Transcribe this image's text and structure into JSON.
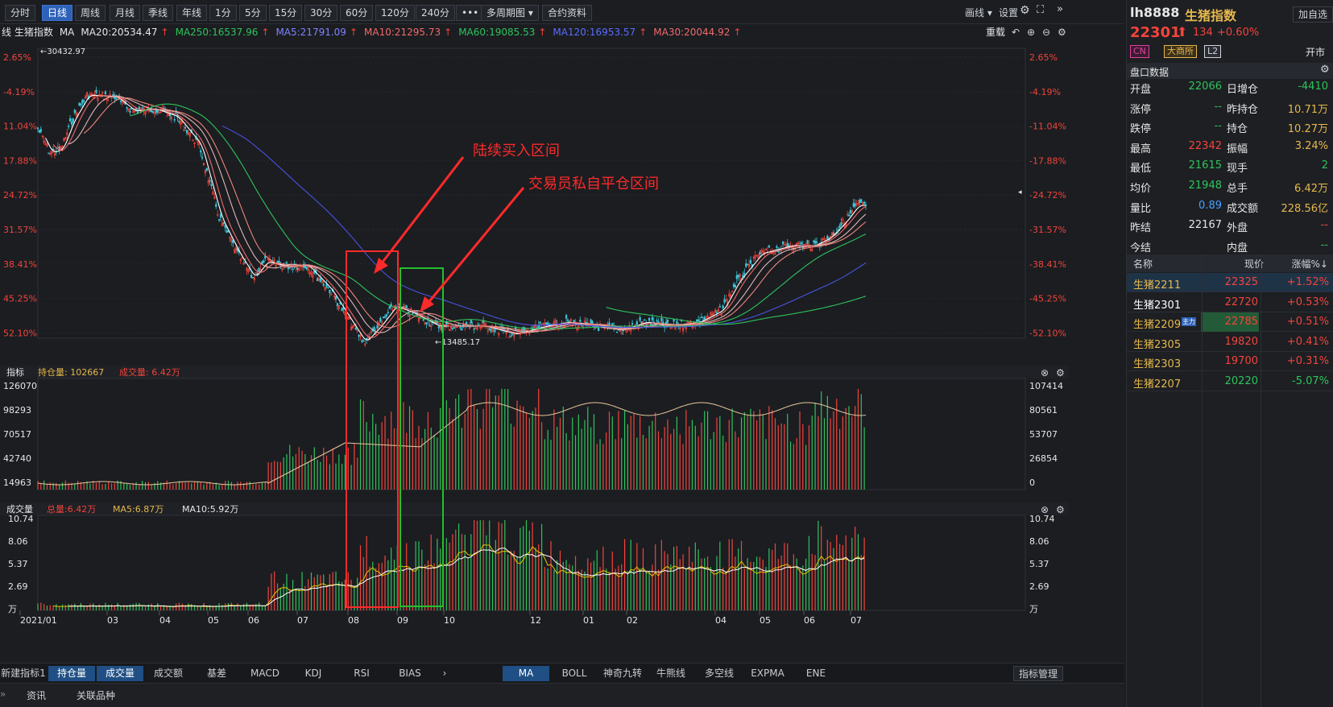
{
  "toolbar": {
    "periods": [
      "分时",
      "日线",
      "周线",
      "月线",
      "季线",
      "年线",
      "1分",
      "5分",
      "15分",
      "30分",
      "60分",
      "120分",
      "240分",
      "•••"
    ],
    "active": "日线",
    "multi": "多周期图 ▾",
    "contract": "合约资料",
    "draw": "画线 ▾",
    "settings": "设置",
    "code": "lh8888",
    "name": "生猪指数",
    "watch": "加自选"
  },
  "mabar": {
    "prefix": "线 生猪指数",
    "ma_label": "MA",
    "items": [
      {
        "text": "MA20:20534.47",
        "color": "#e6e6e6"
      },
      {
        "text": "MA250:16537.96",
        "color": "#2fc35c"
      },
      {
        "text": "MA5:21791.09",
        "color": "#7f84ff"
      },
      {
        "text": "MA10:21295.73",
        "color": "#f26a6a"
      },
      {
        "text": "MA60:19085.53",
        "color": "#2fc35c"
      },
      {
        "text": "MA120:16953.57",
        "color": "#5a6dff"
      },
      {
        "text": "MA30:20044.92",
        "color": "#f26a6a"
      }
    ],
    "restore": "重载"
  },
  "quote": {
    "price": "22301",
    "change": "134",
    "pct": "+0.60%",
    "tags": [
      "CN",
      "大商所",
      "L2"
    ],
    "status": "开市",
    "section": "盘口数据",
    "rows": [
      {
        "l1": "开盘",
        "v1": "22066",
        "c1": "#2fc35c",
        "l2": "日增仓",
        "v2": "-4410",
        "c2": "#2fc35c"
      },
      {
        "l1": "涨停",
        "v1": "--",
        "c1": "#2fc35c",
        "l2": "昨持仓",
        "v2": "10.71万",
        "c2": "#e6b84c"
      },
      {
        "l1": "跌停",
        "v1": "--",
        "c1": "#2fc35c",
        "l2": "持仓",
        "v2": "10.27万",
        "c2": "#e6b84c"
      },
      {
        "l1": "最高",
        "v1": "22342",
        "c1": "#f2443b",
        "l2": "振幅",
        "v2": "3.24%",
        "c2": "#e6b84c"
      },
      {
        "l1": "最低",
        "v1": "21615",
        "c1": "#2fc35c",
        "l2": "现手",
        "v2": "2",
        "c2": "#2fc35c"
      },
      {
        "l1": "均价",
        "v1": "21948",
        "c1": "#2fc35c",
        "l2": "总手",
        "v2": "6.42万",
        "c2": "#e6b84c"
      },
      {
        "l1": "量比",
        "v1": "0.89",
        "c1": "#4aa0ff",
        "l2": "成交额",
        "v2": "228.56亿",
        "c2": "#e6b84c"
      },
      {
        "l1": "昨结",
        "v1": "22167",
        "c1": "#e6e6e6",
        "l2": "外盘",
        "v2": "--",
        "c2": "#f2443b"
      },
      {
        "l1": "今结",
        "v1": "",
        "c1": "#e6e6e6",
        "l2": "内盘",
        "v2": "--",
        "c2": "#2fc35c"
      }
    ],
    "list_headers": [
      "名称",
      "现价",
      "涨幅%↓"
    ],
    "list": [
      {
        "name": "生猪2211",
        "price": "22325",
        "pct": "+1.52%",
        "pc": "#f2443b",
        "nc": "#e6b84c",
        "hl": true
      },
      {
        "name": "生猪2301",
        "price": "22720",
        "pct": "+0.53%",
        "pc": "#f2443b",
        "nc": "#ffffff",
        "hl": false
      },
      {
        "name": "生猪2209",
        "price": "22785",
        "pct": "+0.51%",
        "pc": "#f2443b",
        "nc": "#e6b84c",
        "hl": false,
        "tag": "主力"
      },
      {
        "name": "生猪2305",
        "price": "19820",
        "pct": "+0.41%",
        "pc": "#f2443b",
        "nc": "#e6b84c",
        "hl": false
      },
      {
        "name": "生猪2303",
        "price": "19700",
        "pct": "+0.31%",
        "pc": "#f2443b",
        "nc": "#e6b84c",
        "hl": false
      },
      {
        "name": "生猪2207",
        "price": "20220",
        "pct": "-5.07%",
        "pc": "#2fc35c",
        "nc": "#e6b84c",
        "hl": false
      }
    ]
  },
  "axes": {
    "main_left": [
      "2.65%",
      "-4.19%",
      "11.04%",
      "17.88%",
      "24.72%",
      "31.57%",
      "38.41%",
      "45.25%",
      "52.10%"
    ],
    "main_right": [
      "2.65%",
      "-4.19%",
      "-11.04%",
      "-17.88%",
      "-24.72%",
      "-31.57%",
      "-38.41%",
      "-45.25%",
      "-52.10%"
    ],
    "high_label": "30432.97",
    "low_label": "13485.17",
    "oi_left": [
      "126070",
      "98293",
      "70517",
      "42740",
      "14963"
    ],
    "oi_right": [
      "107414",
      "80561",
      "53707",
      "26854",
      "0"
    ],
    "vol_left": [
      "10.74",
      "8.06",
      "5.37",
      "2.69",
      "万"
    ],
    "vol_right": [
      "10.74",
      "8.06",
      "5.37",
      "2.69",
      "万"
    ],
    "months": [
      "2021/01",
      "03",
      "04",
      "05",
      "06",
      "07",
      "08",
      "09",
      "10",
      "12",
      "01",
      "02",
      "04",
      "05",
      "06",
      "07"
    ]
  },
  "panels": {
    "oi_title": "指标",
    "oi_hold": "持仓量: 102667",
    "oi_vol": "成交量: 6.42万",
    "vol_title": "成交量",
    "vol_total": "总量:6.42万",
    "vol_ma5": "MA5:6.87万",
    "vol_ma10": "MA10:5.92万"
  },
  "annotations": {
    "buy": "陆续买入区间",
    "close": "交易员私自平仓区间"
  },
  "bottom": {
    "left_tabs": [
      "新建指标1",
      "持仓量",
      "成交量",
      "成交额",
      "基差",
      "MACD",
      "KDJ",
      "RSI",
      "BIAS"
    ],
    "active_left": [
      "持仓量",
      "成交量"
    ],
    "right_tabs": [
      "MA",
      "BOLL",
      "神奇九转",
      "牛熊线",
      "多空线",
      "EXPMA",
      "ENE"
    ],
    "active_right": "MA",
    "manage": "指标管理",
    "info": [
      "资讯",
      "关联品种"
    ]
  }
}
